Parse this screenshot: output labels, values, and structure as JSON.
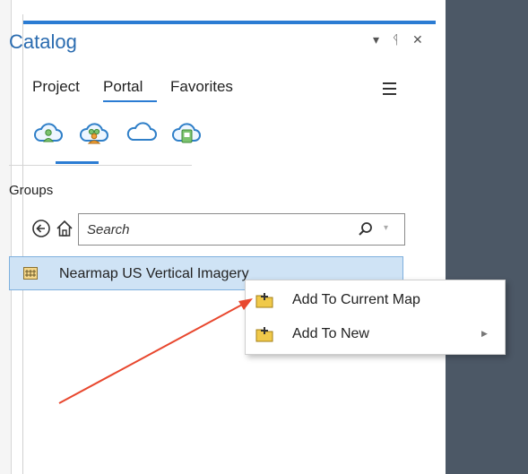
{
  "catalog": {
    "title": "Catalog",
    "controls": {
      "dropdown": "▾",
      "pin": "ᛩ",
      "close": "✕"
    },
    "tabs": [
      {
        "label": "Project"
      },
      {
        "label": "Portal",
        "active": true
      },
      {
        "label": "Favorites"
      }
    ],
    "portal_icons": [
      {
        "icon": "my-content-cloud-icon"
      },
      {
        "icon": "groups-cloud-icon",
        "active": true
      },
      {
        "icon": "all-portal-cloud-icon"
      },
      {
        "icon": "living-atlas-cloud-icon"
      }
    ],
    "section_label": "Groups",
    "search": {
      "placeholder": "Search"
    },
    "items": [
      {
        "label": "Nearmap US Vertical Imagery",
        "icon": "group-grid-icon"
      }
    ]
  },
  "context_menu": {
    "items": [
      {
        "label": "Add To Current Map",
        "icon": "add-folder-icon"
      },
      {
        "label": "Add To New",
        "icon": "add-folder-icon",
        "submenu": true
      }
    ]
  },
  "colors": {
    "accent": "#2b7cd3",
    "selection_bg": "#cfe3f5",
    "dark_pane": "#4c5866",
    "annotation_arrow": "#e8472e"
  }
}
